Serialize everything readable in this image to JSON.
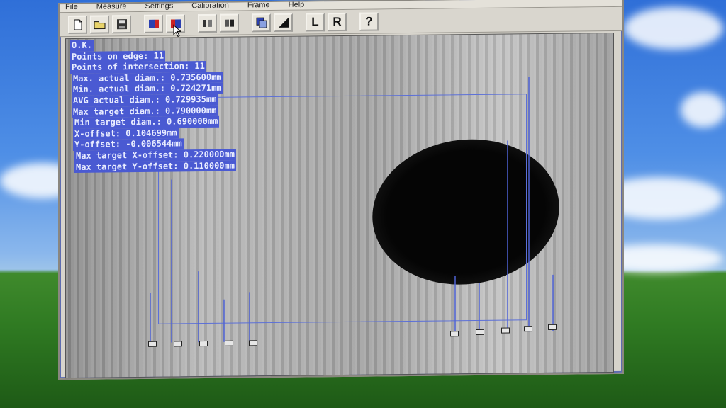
{
  "menu": {
    "items": [
      "File",
      "Measure",
      "Settings",
      "Calibration",
      "Frame",
      "Help"
    ]
  },
  "toolbar": {
    "buttons": [
      {
        "id": "new",
        "icon": "new-document-icon"
      },
      {
        "id": "open",
        "icon": "open-folder-icon"
      },
      {
        "id": "save",
        "icon": "save-disk-icon"
      },
      {
        "id": "export",
        "icon": "export-icon"
      },
      {
        "id": "import",
        "icon": "import-icon"
      },
      {
        "id": "capture",
        "icon": "capture-icon"
      },
      {
        "id": "measure",
        "icon": "measure-icon"
      },
      {
        "id": "overlay",
        "icon": "overlay-icon"
      },
      {
        "id": "contrast",
        "icon": "contrast-icon"
      }
    ],
    "left_label": "L",
    "right_label": "R",
    "help_label": "?"
  },
  "readout": {
    "status": "O.K.",
    "points_on_edge": "Points on edge: 11",
    "points_of_intersection": "Points of intersection: 11",
    "max_actual_diam": "Max. actual diam.: 0.735600mm",
    "min_actual_diam": "Min. actual diam.: 0.724271mm",
    "avg_actual_diam": "AVG actual diam.: 0.729935mm",
    "max_target_diam": "Max target diam.: 0.790000mm",
    "min_target_diam": "Min target diam.: 0.690000mm",
    "x_offset": "X-offset: 0.104699mm",
    "y_offset": "Y-offset: -0.006544mm",
    "max_target_x_offset": "Max target X-offset: 0.220000mm",
    "max_target_y_offset": "Max target Y-offset: 0.110000mm"
  },
  "colors": {
    "overlay_text_bg": "#4a5ad2",
    "overlay_text": "#e8ecff",
    "edge_lines": "#4f63d6",
    "window_bg": "#d7d4cc"
  }
}
